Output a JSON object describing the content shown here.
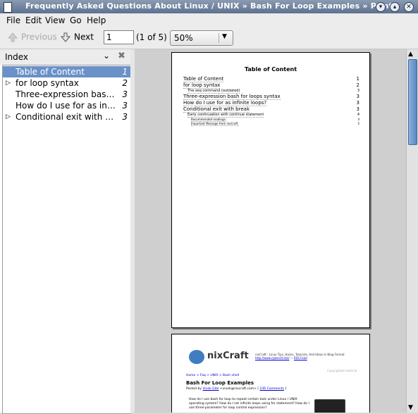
{
  "window": {
    "title": "Frequently Asked Questions About Linux / UNIX » Bash For Loop Examples » Print"
  },
  "menu": [
    "File",
    "Edit",
    "View",
    "Go",
    "Help"
  ],
  "toolbar": {
    "previous_label": "Previous",
    "next_label": "Next",
    "page_value": "1",
    "page_count": "(1 of 5)",
    "zoom_value": "50%"
  },
  "sidebar": {
    "title": "Index",
    "items": [
      {
        "label": "Table of Content",
        "page": "1",
        "expandable": false,
        "selected": true
      },
      {
        "label": "for loop syntax",
        "page": "2",
        "expandable": true,
        "selected": false
      },
      {
        "label": "Three-expression bash for loops syntax",
        "page": "3",
        "expandable": false,
        "selected": false
      },
      {
        "label": "How do I use for as infinite loops?",
        "page": "3",
        "expandable": false,
        "selected": false
      },
      {
        "label": "Conditional exit with break",
        "page": "3",
        "expandable": true,
        "selected": false
      }
    ]
  },
  "document": {
    "page1": {
      "heading": "Table of Content",
      "entries": [
        {
          "text": "Table of Content",
          "page": "1",
          "level": 1
        },
        {
          "text": "for loop syntax",
          "page": "2",
          "level": 1
        },
        {
          "text": "The seq command (outdated)",
          "page": "3",
          "level": 2
        },
        {
          "text": "Three-expression bash for loops syntax",
          "page": "3",
          "level": 1
        },
        {
          "text": "How do I use for as infinite loops?",
          "page": "3",
          "level": 1
        },
        {
          "text": "Conditional exit with break",
          "page": "3",
          "level": 1
        },
        {
          "text": "Early continuation with continue statement",
          "page": "4",
          "level": 2
        },
        {
          "text": "Recommended readings:",
          "page": "4",
          "level": 3
        },
        {
          "text": "Important Message from nixCraft:",
          "page": "5",
          "level": 3
        }
      ]
    },
    "page2": {
      "logo_text": "nixCraft",
      "tagline": "nixCraft : Linux Tips, Hacks, Tutorials, And Ideas In Blog Format",
      "tagline_url": "http://www.cyberciti.biz/",
      "tagline_rss": "RSS Feed",
      "breadcrumb": "Home > Faq > UNIX > Bash shell",
      "heading": "Bash For Loop Examples",
      "byline_prefix": "Posted by",
      "byline_author": "Vivek Gite",
      "byline_rest": "<vivek@nixcraft.com> [",
      "byline_comments": "236 Comments",
      "byline_close": "]",
      "body": "How do I use bash for loop to repeat certain task under Linux / UNIX operating system? How do I set infinite loops using for statement? How do I use three-parameter for loop control expression?",
      "watermark": "Copyrighted material"
    }
  }
}
